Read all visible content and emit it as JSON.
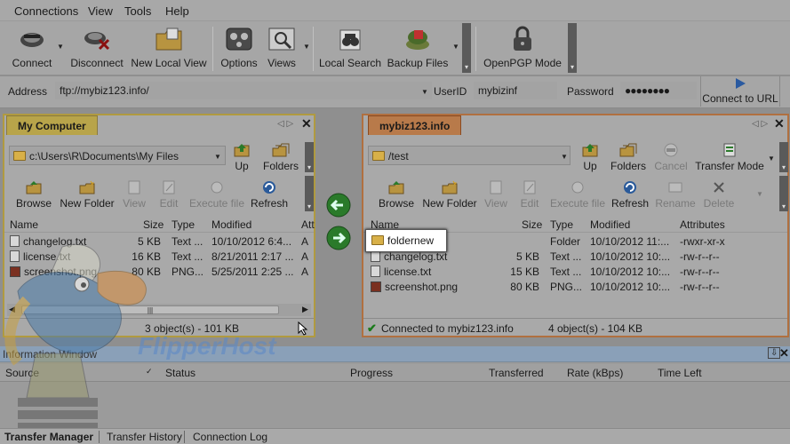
{
  "menu": [
    "Connections",
    "View",
    "Tools",
    "Help"
  ],
  "toolbar": {
    "connect": "Connect",
    "disconnect": "Disconnect",
    "new_local_view": "New Local View",
    "options": "Options",
    "views": "Views",
    "local_search": "Local Search",
    "backup_files": "Backup Files",
    "openpgp": "OpenPGP Mode"
  },
  "address": {
    "label": "Address",
    "value": "ftp://mybiz123.info/",
    "userid_label": "UserID",
    "userid_value": "mybizinf",
    "password_label": "Password",
    "password_value": "●●●●●●●●",
    "connect_url": "Connect to URL"
  },
  "left_panel": {
    "tab": "My Computer",
    "path": "c:\\Users\\R\\Documents\\My Files",
    "up": "Up",
    "folders": "Folders",
    "browse": "Browse",
    "new_folder": "New Folder",
    "view": "View",
    "edit": "Edit",
    "execute": "Execute file",
    "refresh": "Refresh",
    "columns": [
      "Name",
      "Size",
      "Type",
      "Modified",
      "Att"
    ],
    "rows": [
      {
        "name": "changelog.txt",
        "size": "5 KB",
        "type": "Text ...",
        "modified": "10/10/2012 6:4...",
        "attr": "A"
      },
      {
        "name": "license.txt",
        "size": "16 KB",
        "type": "Text ...",
        "modified": "8/21/2011 2:17 ...",
        "attr": "A"
      },
      {
        "name": "screenshot.png",
        "size": "80 KB",
        "type": "PNG...",
        "modified": "5/25/2011 2:25 ...",
        "attr": "A"
      }
    ],
    "status": "3 object(s) - 101 KB"
  },
  "right_panel": {
    "tab": "mybiz123.info",
    "path": "/test",
    "up": "Up",
    "folders": "Folders",
    "cancel": "Cancel",
    "transfer_mode": "Transfer Mode",
    "browse": "Browse",
    "new_folder": "New Folder",
    "view": "View",
    "edit": "Edit",
    "execute": "Execute file",
    "refresh": "Refresh",
    "rename": "Rename",
    "delete": "Delete",
    "columns": [
      "Name",
      "Size",
      "Type",
      "Modified",
      "Attributes"
    ],
    "rows": [
      {
        "name": "foldernew",
        "size": "",
        "type": "Folder",
        "modified": "10/10/2012 11:...",
        "attr": "-rwxr-xr-x"
      },
      {
        "name": "changelog.txt",
        "size": "5 KB",
        "type": "Text ...",
        "modified": "10/10/2012 10:...",
        "attr": "-rw-r--r--"
      },
      {
        "name": "license.txt",
        "size": "15 KB",
        "type": "Text ...",
        "modified": "10/10/2012 10:...",
        "attr": "-rw-r--r--"
      },
      {
        "name": "screenshot.png",
        "size": "80 KB",
        "type": "PNG...",
        "modified": "10/10/2012 10:...",
        "attr": "-rw-r--r--"
      }
    ],
    "status_connected": "Connected to mybiz123.info",
    "status_objects": "4 object(s) - 104 KB"
  },
  "info_window": {
    "title": "Information Window",
    "columns": [
      "Source",
      "Status",
      "Progress",
      "Transferred",
      "Rate (kBps)",
      "Time Left"
    ]
  },
  "bottom_tabs": [
    "Transfer Manager",
    "Transfer History",
    "Connection Log"
  ],
  "watermark": "FlipperHost"
}
